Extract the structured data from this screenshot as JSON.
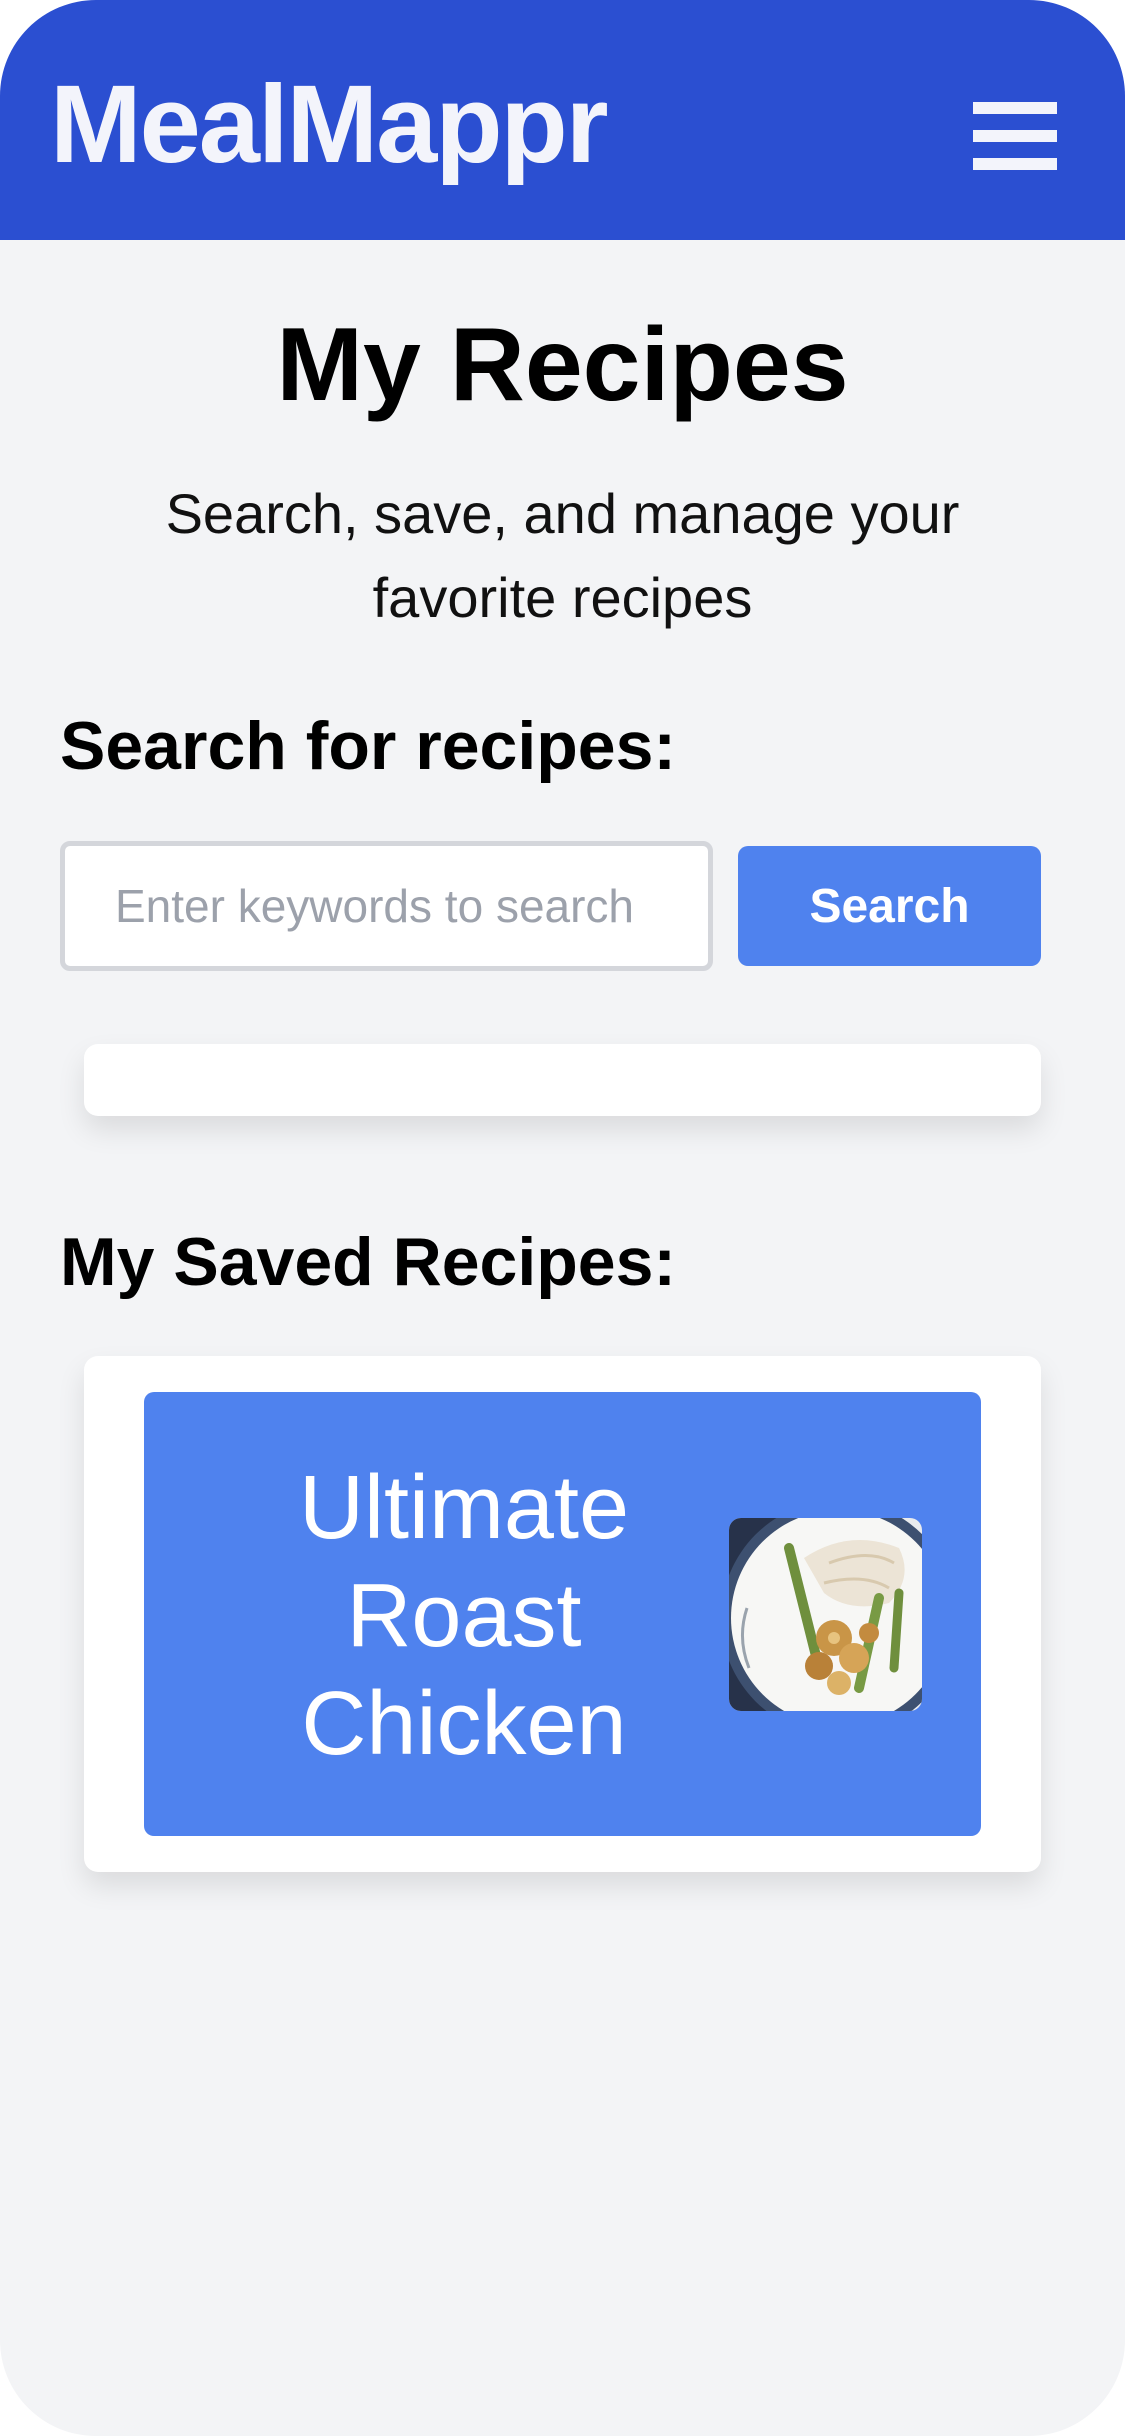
{
  "app": {
    "brand": "MealMappr",
    "menu_icon": "hamburger-menu-icon"
  },
  "page": {
    "title": "My Recipes",
    "subtitle": "Search, save, and manage your favorite recipes"
  },
  "search": {
    "heading": "Search for recipes:",
    "placeholder": "Enter keywords to search",
    "value": "",
    "button_label": "Search"
  },
  "results": {
    "items": []
  },
  "saved": {
    "heading": "My Saved Recipes:",
    "recipes": [
      {
        "title": "Ultimate Roast Chicken"
      }
    ]
  },
  "colors": {
    "header": "#2b4fd1",
    "accent": "#4f82ee",
    "background": "#f3f4f6"
  }
}
